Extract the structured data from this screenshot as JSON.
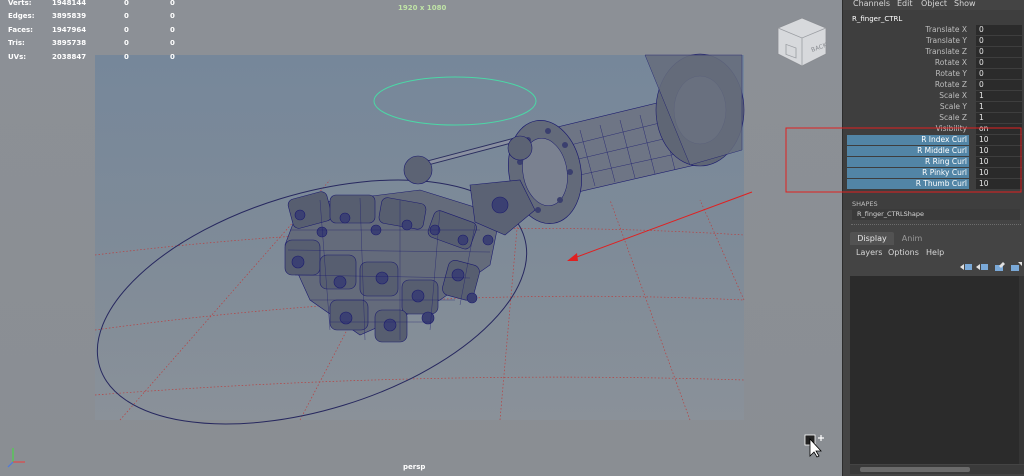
{
  "hud": {
    "stats": [
      {
        "label": "Verts:",
        "v1": "1948144",
        "v2": "0",
        "v3": "0"
      },
      {
        "label": "Edges:",
        "v1": "3895839",
        "v2": "0",
        "v3": "0"
      },
      {
        "label": "Faces:",
        "v1": "1947964",
        "v2": "0",
        "v3": "0"
      },
      {
        "label": "Tris:",
        "v1": "3895738",
        "v2": "0",
        "v3": "0"
      },
      {
        "label": "UVs:",
        "v1": "2038847",
        "v2": "0",
        "v3": "0"
      }
    ],
    "resolution": "1920 x 1080",
    "camera": "persp",
    "viewcube_face": "BACK"
  },
  "channel_box": {
    "menu": [
      "Channels",
      "Edit",
      "Object",
      "Show"
    ],
    "object_name": "R_finger_CTRL",
    "attributes": [
      {
        "name": "Translate X",
        "value": "0"
      },
      {
        "name": "Translate Y",
        "value": "0"
      },
      {
        "name": "Translate Z",
        "value": "0"
      },
      {
        "name": "Rotate X",
        "value": "0"
      },
      {
        "name": "Rotate Y",
        "value": "0"
      },
      {
        "name": "Rotate Z",
        "value": "0"
      },
      {
        "name": "Scale X",
        "value": "1"
      },
      {
        "name": "Scale Y",
        "value": "1"
      },
      {
        "name": "Scale Z",
        "value": "1"
      },
      {
        "name": "Visibility",
        "value": "on"
      },
      {
        "name": "R Index Curl",
        "value": "10"
      },
      {
        "name": "R Middle Curl",
        "value": "10"
      },
      {
        "name": "R Ring Curl",
        "value": "10"
      },
      {
        "name": "R Pinky Curl",
        "value": "10"
      },
      {
        "name": "R Thumb Curl",
        "value": "10"
      }
    ],
    "shapes_label": "SHAPES",
    "shape_name": "R_finger_CTRLShape"
  },
  "layer_editor": {
    "tabs": [
      "Display",
      "Anim"
    ],
    "active_tab": "Display",
    "menu": [
      "Layers",
      "Options",
      "Help"
    ]
  },
  "colors": {
    "highlight": "#5285a6",
    "annotation_red": "#e02020",
    "control_curve": "#27285f",
    "ring_control": "#4bd8a6",
    "wireframe": "#1c1c6e"
  }
}
